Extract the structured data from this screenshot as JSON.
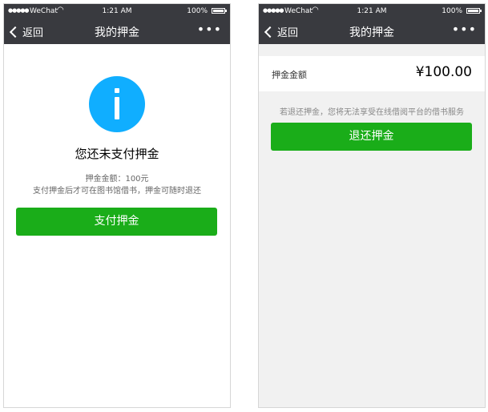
{
  "status_bar": {
    "carrier": "WeChat",
    "time": "1:21 AM",
    "battery": "100%"
  },
  "left_screen": {
    "nav": {
      "back_label": "返回",
      "title": "我的押金",
      "more": "•••"
    },
    "title": "您还未支付押金",
    "amount_line": "押金金额：100元",
    "desc_line": "支付押金后才可在图书馆借书，押金可随时退还",
    "pay_button": "支付押金"
  },
  "right_screen": {
    "nav": {
      "back_label": "返回",
      "title": "我的押金",
      "more": "•••"
    },
    "amount_label": "押金金额",
    "amount_value": "¥100.00",
    "notice": "若退还押金，您将无法享受在线借阅平台的借书服务",
    "refund_button": "退还押金"
  },
  "colors": {
    "nav_bg": "#393a3f",
    "primary_green": "#1aad19",
    "info_blue": "#10aeff"
  },
  "icons": [
    "signal-icon",
    "wifi-icon",
    "battery-icon",
    "back-chevron-icon",
    "more-icon",
    "info-icon"
  ]
}
